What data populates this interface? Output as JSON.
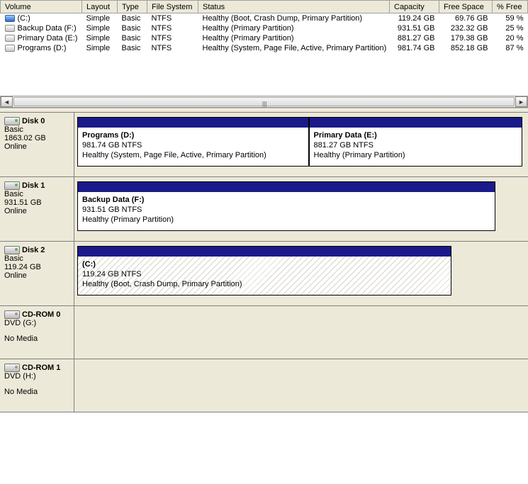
{
  "columns": {
    "volume": "Volume",
    "layout": "Layout",
    "type": "Type",
    "fs": "File System",
    "status": "Status",
    "capacity": "Capacity",
    "free": "Free Space",
    "pctfree": "% Free"
  },
  "volumes": [
    {
      "icon": "active",
      "name": "(C:)",
      "layout": "Simple",
      "type": "Basic",
      "fs": "NTFS",
      "status": "Healthy (Boot, Crash Dump, Primary Partition)",
      "capacity": "119.24 GB",
      "free": "69.76 GB",
      "pctfree": "59 %"
    },
    {
      "icon": "drive",
      "name": "Backup Data (F:)",
      "layout": "Simple",
      "type": "Basic",
      "fs": "NTFS",
      "status": "Healthy (Primary Partition)",
      "capacity": "931.51 GB",
      "free": "232.32 GB",
      "pctfree": "25 %"
    },
    {
      "icon": "drive",
      "name": "Primary Data (E:)",
      "layout": "Simple",
      "type": "Basic",
      "fs": "NTFS",
      "status": "Healthy (Primary Partition)",
      "capacity": "881.27 GB",
      "free": "179.38 GB",
      "pctfree": "20 %"
    },
    {
      "icon": "drive",
      "name": "Programs (D:)",
      "layout": "Simple",
      "type": "Basic",
      "fs": "NTFS",
      "status": "Healthy (System, Page File, Active, Primary Partition)",
      "capacity": "981.74 GB",
      "free": "852.18 GB",
      "pctfree": "87 %"
    }
  ],
  "disks": [
    {
      "title": "Disk 0",
      "type": "Basic",
      "size": "1863.02 GB",
      "state": "Online",
      "icon": "hdd",
      "partitions": [
        {
          "name": "Programs  (D:)",
          "line2": "981.74 GB NTFS",
          "line3": "Healthy (System, Page File, Active, Primary Partition)",
          "widthpct": 52,
          "hatched": false
        },
        {
          "name": "Primary Data  (E:)",
          "line2": "881.27 GB NTFS",
          "line3": "Healthy (Primary Partition)",
          "widthpct": 48,
          "hatched": false
        }
      ],
      "containerpct": 100
    },
    {
      "title": "Disk 1",
      "type": "Basic",
      "size": "931.51 GB",
      "state": "Online",
      "icon": "hdd",
      "partitions": [
        {
          "name": "Backup Data  (F:)",
          "line2": "931.51 GB NTFS",
          "line3": "Healthy (Primary Partition)",
          "widthpct": 100,
          "hatched": false
        }
      ],
      "containerpct": 94
    },
    {
      "title": "Disk 2",
      "type": "Basic",
      "size": "119.24 GB",
      "state": "Online",
      "icon": "hdd",
      "partitions": [
        {
          "name": "(C:)",
          "line2": "119.24 GB NTFS",
          "line3": "Healthy (Boot, Crash Dump, Primary Partition)",
          "widthpct": 100,
          "hatched": true
        }
      ],
      "containerpct": 84
    },
    {
      "title": "CD-ROM 0",
      "type": "DVD (G:)",
      "size": "",
      "state": "No Media",
      "icon": "cd",
      "partitions": [],
      "containerpct": 100
    },
    {
      "title": "CD-ROM 1",
      "type": "DVD (H:)",
      "size": "",
      "state": "No Media",
      "icon": "cd",
      "partitions": [],
      "containerpct": 100
    }
  ]
}
